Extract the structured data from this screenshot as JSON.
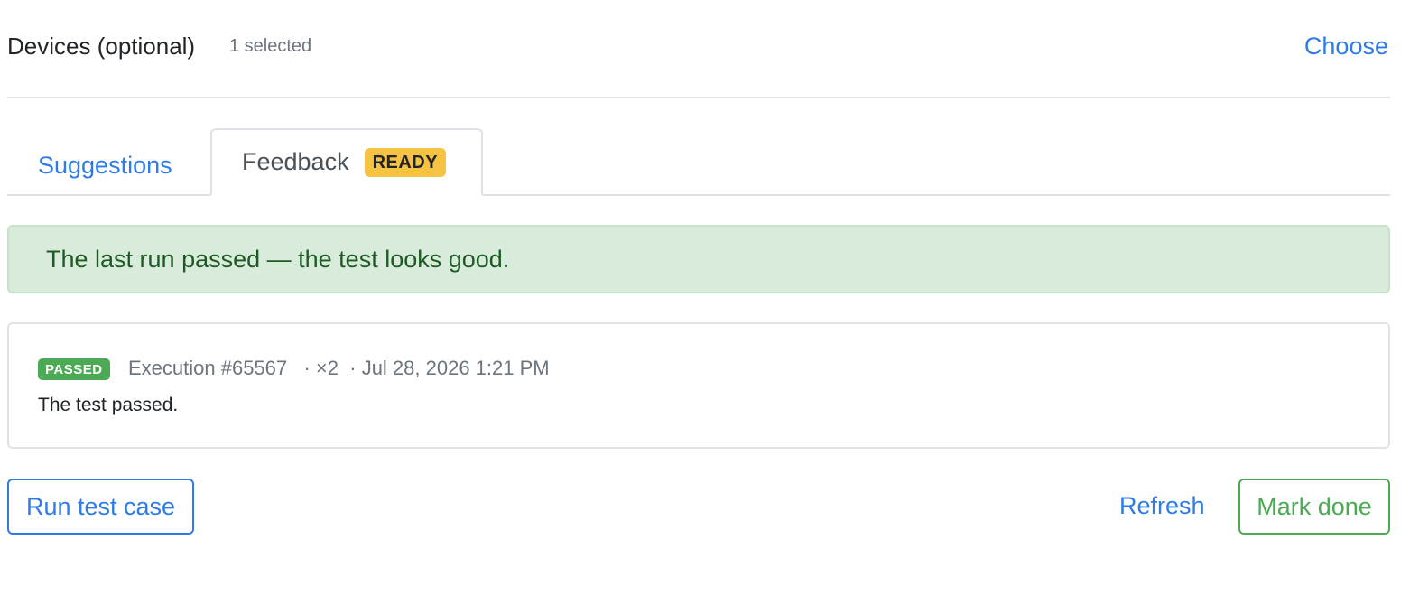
{
  "devices": {
    "title": "Devices (optional)",
    "count_text": "1 selected",
    "choose_label": "Choose"
  },
  "tabs": [
    {
      "label": "Suggestions",
      "active": false
    },
    {
      "label": "Feedback",
      "active": true,
      "badge": "READY"
    }
  ],
  "alert": {
    "message": "The last run passed — the test looks good.",
    "color": "#d9ecdc"
  },
  "run": {
    "status": "PASSED",
    "execution": "Execution #65567",
    "multiplier": "· ×2",
    "timestamp": "· Jul 28, 2026 1:21 PM",
    "message": "The test passed."
  },
  "actions": {
    "run_label": "Run test case",
    "refresh_label": "Refresh",
    "done_label": "Mark done"
  },
  "colors": {
    "accent": "#2f7be8",
    "success": "#4caa55",
    "warning": "#f5c242"
  }
}
